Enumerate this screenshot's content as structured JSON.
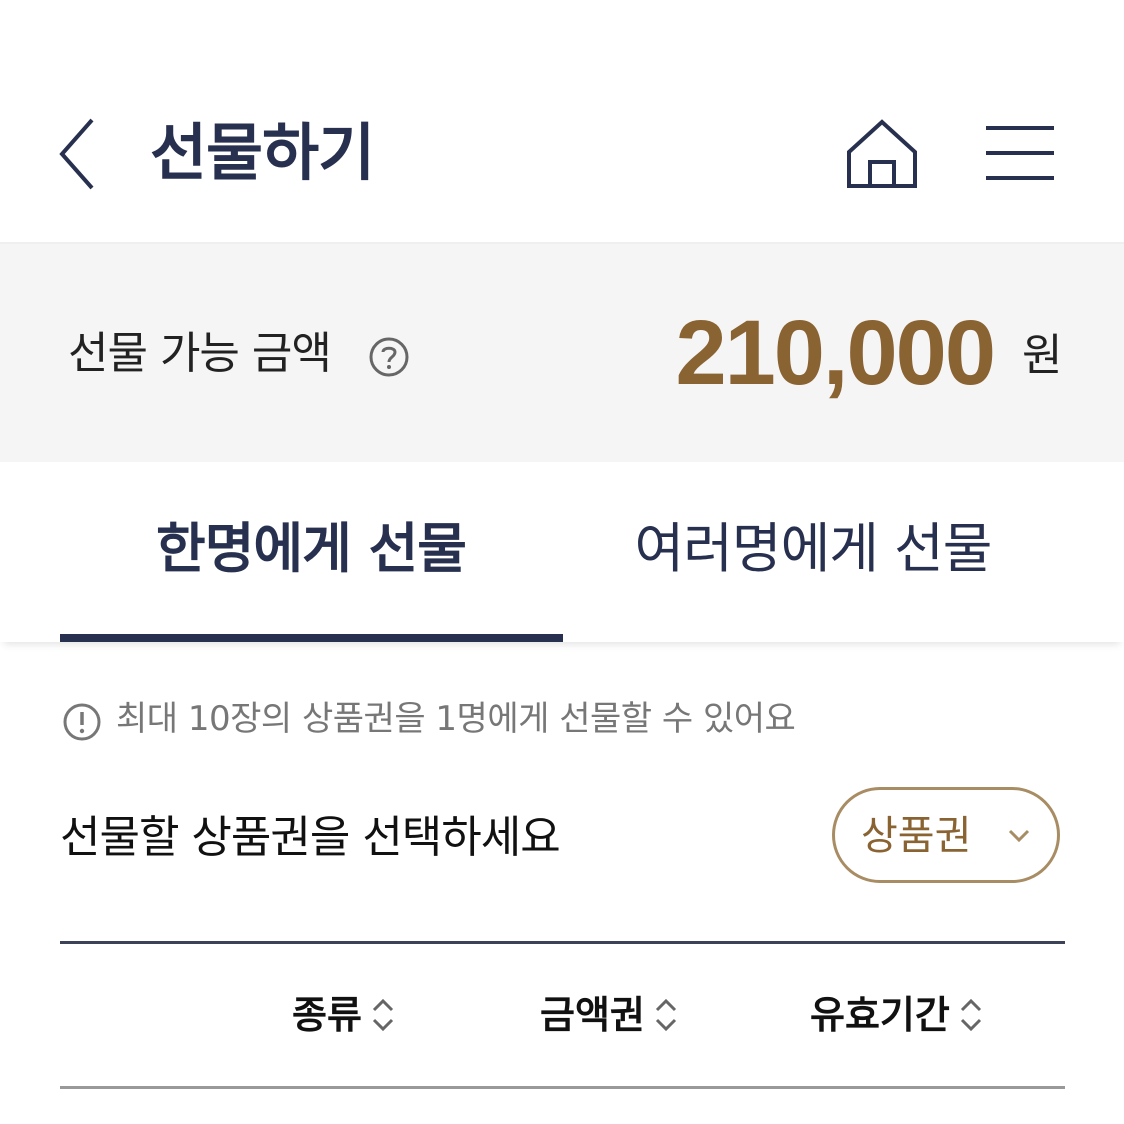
{
  "header": {
    "title": "선물하기",
    "back_icon": "chevron-left-icon",
    "home_icon": "home-icon",
    "menu_icon": "hamburger-menu-icon"
  },
  "balance": {
    "label": "선물 가능 금액",
    "help_icon": "question-circle-icon",
    "amount": "210,000",
    "unit": "원"
  },
  "tabs": [
    {
      "label": "한명에게 선물",
      "active": true
    },
    {
      "label": "여러명에게 선물",
      "active": false
    }
  ],
  "notice": {
    "icon": "exclamation-circle-icon",
    "text": "최대 10장의 상품권을 1명에게 선물할 수 있어요"
  },
  "voucher_select": {
    "label": "선물할 상품권을 선택하세요",
    "selected": "상품권",
    "icon": "chevron-down-icon"
  },
  "table": {
    "columns": [
      "종류",
      "금액권",
      "유효기간"
    ],
    "sort_icon": "sort-updown-icon"
  },
  "colors": {
    "navy": "#27304f",
    "gold": "#8a6333",
    "gold_border": "#a88c63",
    "balance_bg": "#f5f5f5"
  }
}
